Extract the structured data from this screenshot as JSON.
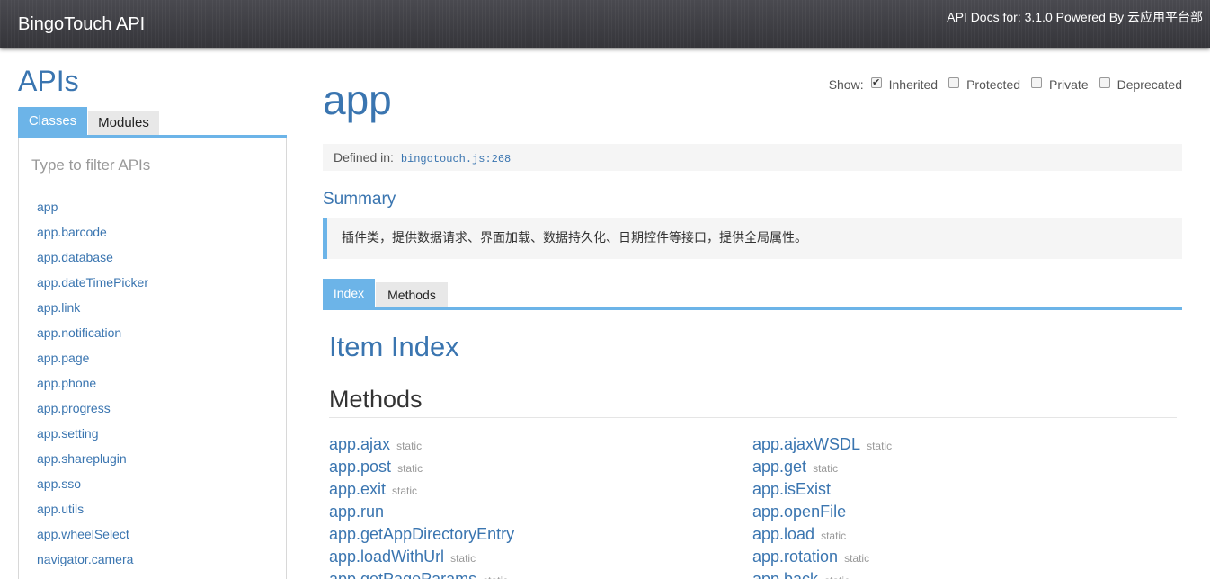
{
  "header": {
    "brand": "BingoTouch API",
    "version_text": "API Docs for: 3.1.0 Powered By 云应用平台部"
  },
  "sidebar": {
    "title": "APIs",
    "tabs": [
      {
        "label": "Classes",
        "active": true
      },
      {
        "label": "Modules",
        "active": false
      }
    ],
    "filter_placeholder": "Type to filter APIs",
    "classes": [
      "app",
      "app.barcode",
      "app.database",
      "app.dateTimePicker",
      "app.link",
      "app.notification",
      "app.page",
      "app.phone",
      "app.progress",
      "app.setting",
      "app.shareplugin",
      "app.sso",
      "app.utils",
      "app.wheelSelect",
      "navigator.camera"
    ]
  },
  "show_options": {
    "label": "Show:",
    "options": [
      {
        "label": "Inherited",
        "checked": true
      },
      {
        "label": "Protected",
        "checked": false
      },
      {
        "label": "Private",
        "checked": false
      },
      {
        "label": "Deprecated",
        "checked": false
      }
    ]
  },
  "main": {
    "title": "app",
    "defined_in_label": "Defined in:",
    "defined_in_file": "bingotouch.js:268",
    "summary_heading": "Summary",
    "summary_text": "插件类，提供数据请求、界面加载、数据持久化、日期控件等接口，提供全局属性。",
    "tabs": [
      {
        "label": "Index",
        "active": true
      },
      {
        "label": "Methods",
        "active": false
      }
    ],
    "item_index_heading": "Item Index",
    "methods_heading": "Methods",
    "methods_col1": [
      {
        "name": "app.ajax",
        "flag": "static"
      },
      {
        "name": "app.post",
        "flag": "static"
      },
      {
        "name": "app.exit",
        "flag": "static"
      },
      {
        "name": "app.run",
        "flag": ""
      },
      {
        "name": "app.getAppDirectoryEntry",
        "flag": ""
      },
      {
        "name": "app.loadWithUrl",
        "flag": "static"
      },
      {
        "name": "app.getPageParams",
        "flag": "static"
      }
    ],
    "methods_col2": [
      {
        "name": "app.ajaxWSDL",
        "flag": "static"
      },
      {
        "name": "app.get",
        "flag": "static"
      },
      {
        "name": "app.isExist",
        "flag": ""
      },
      {
        "name": "app.openFile",
        "flag": ""
      },
      {
        "name": "app.load",
        "flag": "static"
      },
      {
        "name": "app.rotation",
        "flag": "static"
      },
      {
        "name": "app.back",
        "flag": "static"
      }
    ]
  }
}
